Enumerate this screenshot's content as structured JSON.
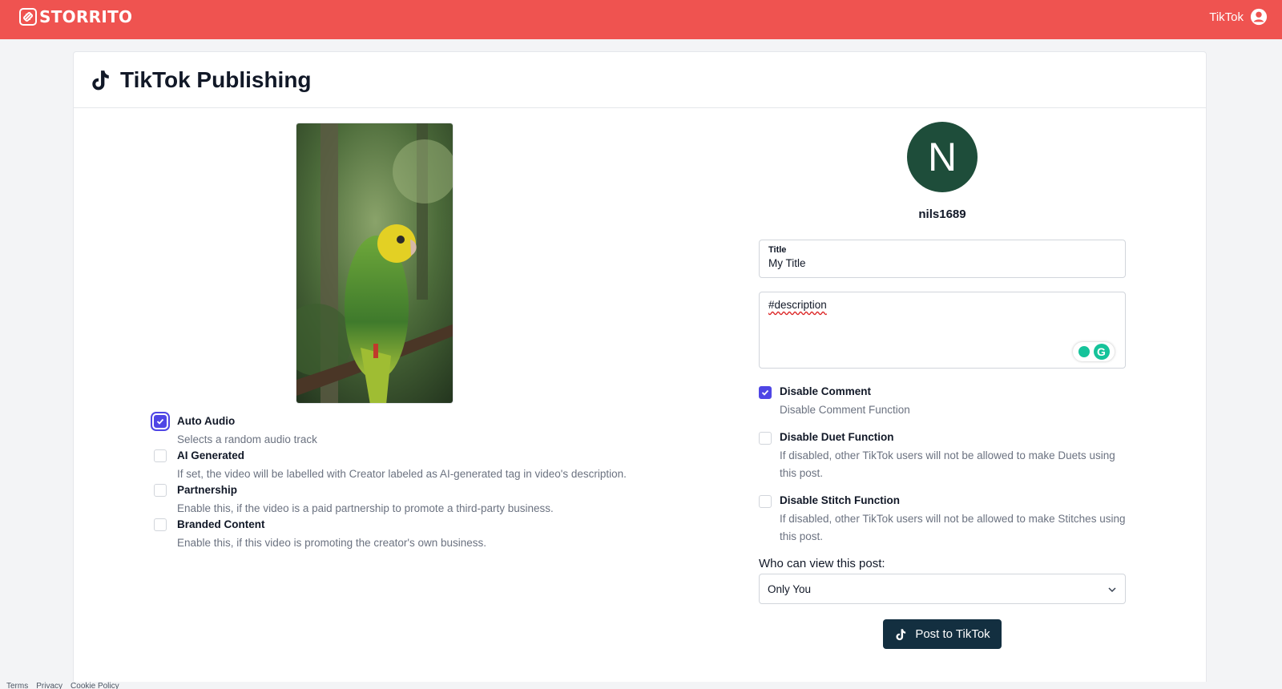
{
  "header": {
    "brand": "STORRITO",
    "account_label": "TikTok"
  },
  "page": {
    "title": "TikTok Publishing"
  },
  "left_options": [
    {
      "label": "Auto Audio",
      "description": "Selects a random audio track",
      "checked": true
    },
    {
      "label": "AI Generated",
      "description": "If set, the video will be labelled with Creator labeled as AI-generated tag in video's description.",
      "checked": false
    },
    {
      "label": "Partnership",
      "description": "Enable this, if the video is a paid partnership to promote a third-party business.",
      "checked": false
    },
    {
      "label": "Branded Content",
      "description": "Enable this, if this video is promoting the creator's own business.",
      "checked": false
    }
  ],
  "profile": {
    "avatar_initial": "N",
    "username": "nils1689"
  },
  "form": {
    "title_label": "Title",
    "title_value": "My Title",
    "description_value": "#description"
  },
  "right_options": [
    {
      "label": "Disable Comment",
      "description": "Disable Comment Function",
      "checked": true
    },
    {
      "label": "Disable Duet Function",
      "description": "If disabled, other TikTok users will not be allowed to make Duets using this post.",
      "checked": false
    },
    {
      "label": "Disable Stitch Function",
      "description": "If disabled, other TikTok users will not be allowed to make Stitches using this post.",
      "checked": false
    }
  ],
  "privacy": {
    "label": "Who can view this post:",
    "selected": "Only You"
  },
  "post_button": "Post to TikTok",
  "footer": {
    "links": [
      "Terms",
      "Privacy",
      "Cookie Policy"
    ]
  },
  "colors": {
    "brand": "#ef5350",
    "accent": "#4f46e5",
    "button": "#132f40",
    "avatar": "#1e4d3a"
  }
}
